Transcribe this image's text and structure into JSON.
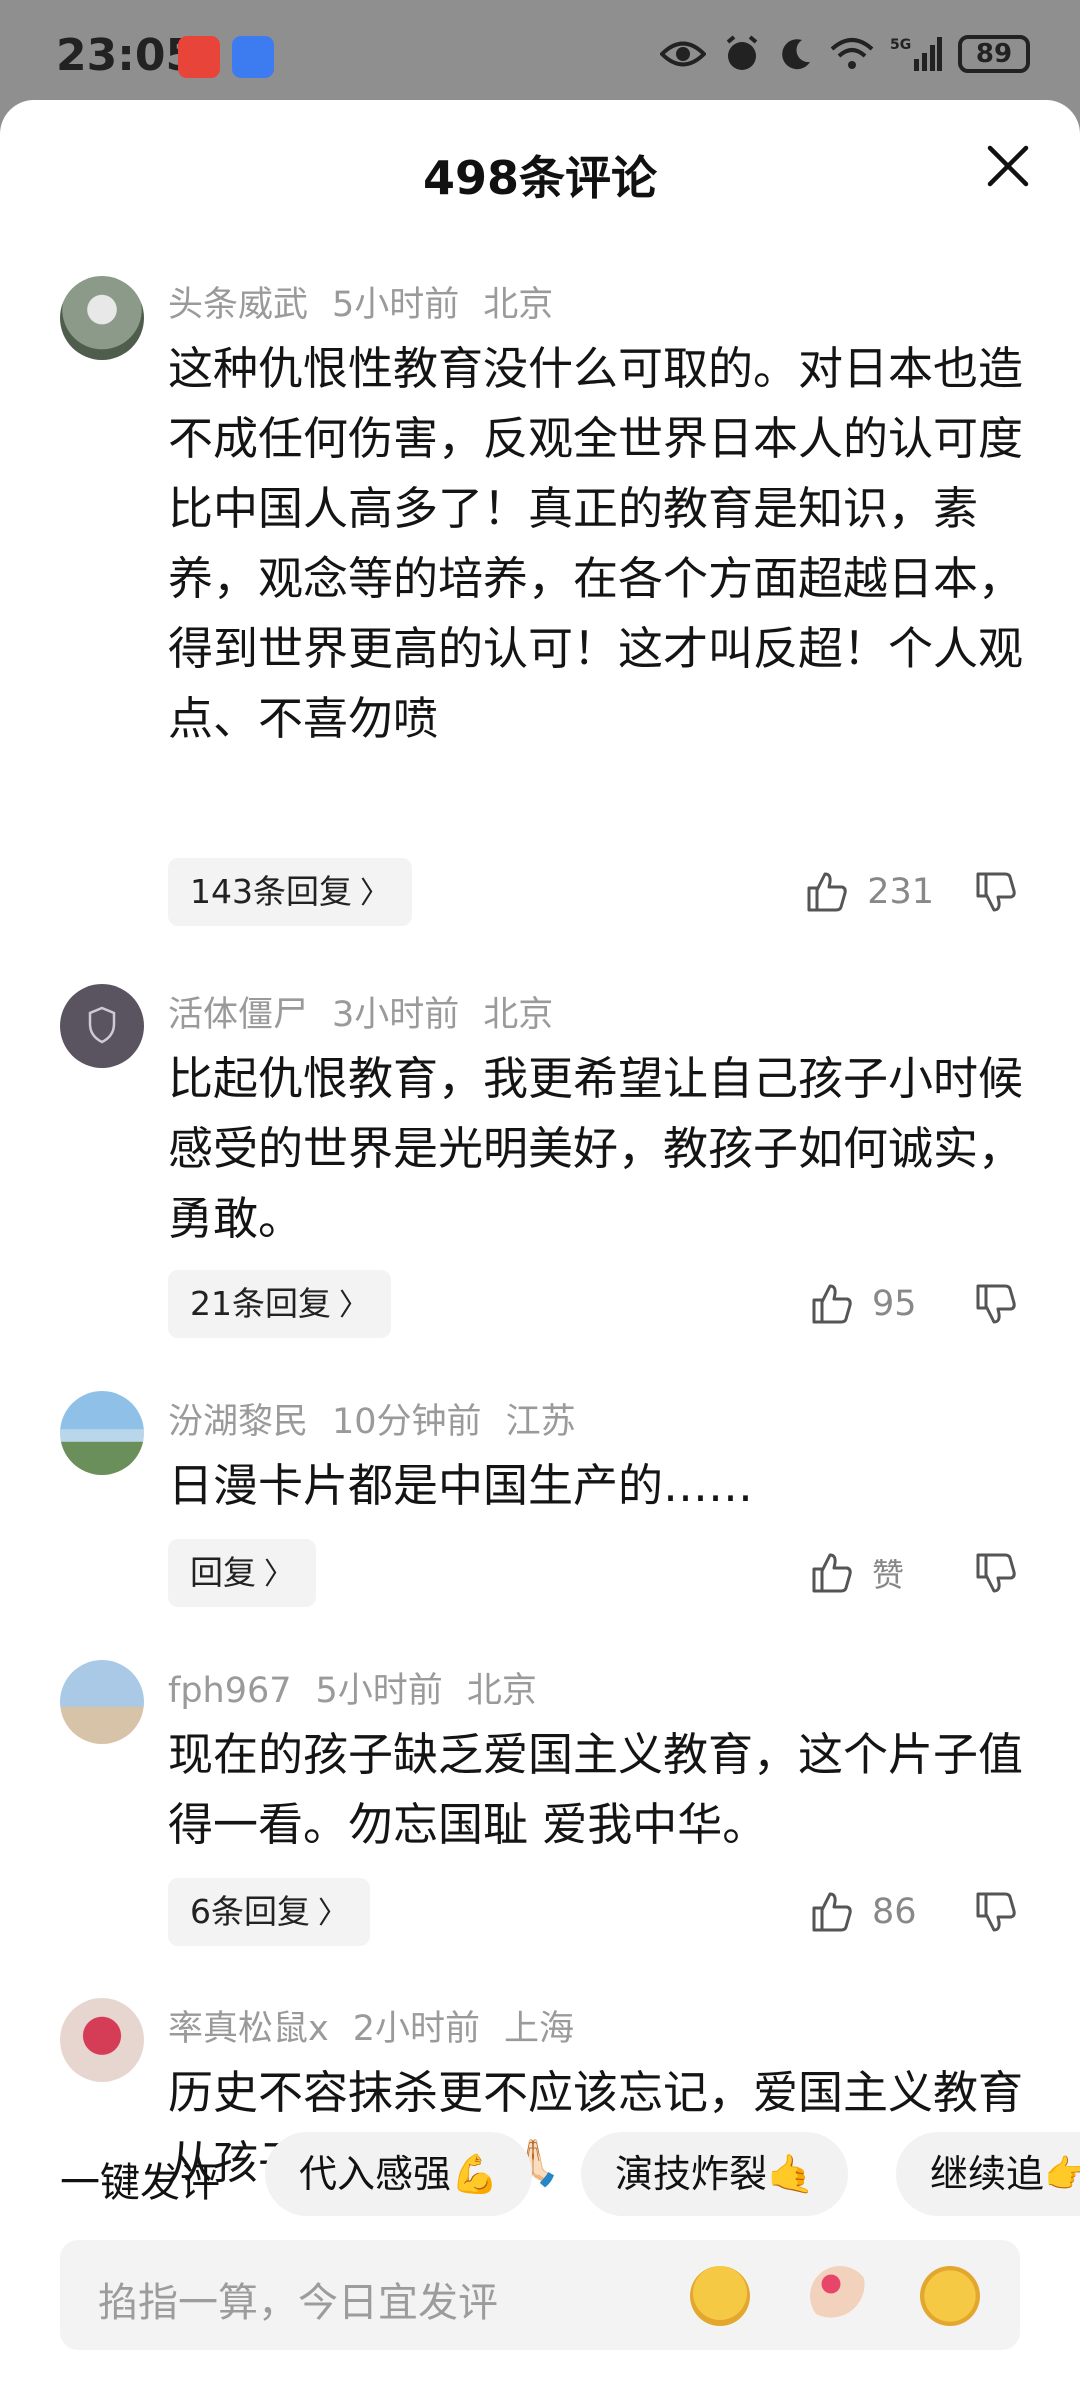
{
  "status_bar": {
    "time": "23:05",
    "battery": "89",
    "network": "5G"
  },
  "sheet": {
    "title": "498条评论"
  },
  "comments": [
    {
      "user": "头条威武",
      "time": "5小时前",
      "location": "北京",
      "text": "这种仇恨性教育没什么可取的。对日本也造不成任何伤害，反观全世界日本人的认可度比中国人高多了！真正的教育是知识，素养，观念等的培养，在各个方面超越日本，得到世界更高的认可！这才叫反超！个人观点、不喜勿喷",
      "replies": "143条回复",
      "likes": "231"
    },
    {
      "user": "活体僵尸",
      "time": "3小时前",
      "location": "北京",
      "text": "比起仇恨教育，我更希望让自己孩子小时候感受的世界是光明美好，教孩子如何诚实，勇敢。",
      "replies": "21条回复",
      "likes": "95"
    },
    {
      "user": "汾湖黎民",
      "time": "10分钟前",
      "location": "江苏",
      "text": "日漫卡片都是中国生产的……",
      "replies": "回复",
      "likes": "赞"
    },
    {
      "user": "fph967",
      "time": "5小时前",
      "location": "北京",
      "text": "现在的孩子缺乏爱国主义教育，这个片子值得一看。勿忘国耻 爱我中华。",
      "replies": "6条回复",
      "likes": "86"
    },
    {
      "user": "率真松鼠x",
      "time": "2小时前",
      "location": "上海",
      "text": "历史不容抹杀更不应该忘记，爱国主义教育从孩子开始🙏🏻🙏🏻🙏🏻",
      "replies": "",
      "likes": ""
    }
  ],
  "quick_reply": {
    "label": "一键发评",
    "chips": [
      "代入感强💪",
      "演技炸裂🤙",
      "继续追👉"
    ]
  },
  "input": {
    "placeholder": "掐指一算，今日宜发评"
  },
  "icons": [
    "eye-icon",
    "alarm-icon",
    "moon-icon",
    "wifi-icon",
    "signal-icon",
    "close-icon",
    "thumb-up-icon",
    "thumb-down-icon",
    "chevron-right-icon"
  ]
}
